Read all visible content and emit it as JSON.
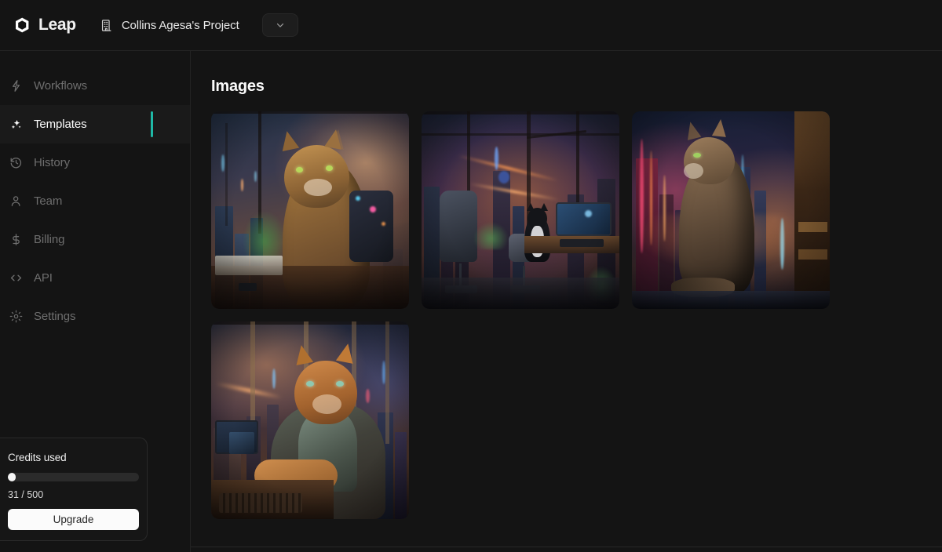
{
  "header": {
    "brand_name": "Leap",
    "brand_logo_icon": "cube-logo-icon",
    "project_icon": "building-icon",
    "project_name": "Collins Agesa's Project",
    "dropdown_icon": "chevron-down-icon"
  },
  "sidebar": {
    "items": [
      {
        "label": "Workflows",
        "icon": "lightning-bolt-icon",
        "active": false
      },
      {
        "label": "Templates",
        "icon": "sparkles-icon",
        "active": true
      },
      {
        "label": "History",
        "icon": "clock-rotate-icon",
        "active": false
      },
      {
        "label": "Team",
        "icon": "person-icon",
        "active": false
      },
      {
        "label": "Billing",
        "icon": "dollar-sign-icon",
        "active": false
      },
      {
        "label": "API",
        "icon": "code-brackets-icon",
        "active": false
      },
      {
        "label": "Settings",
        "icon": "gear-icon",
        "active": false
      }
    ],
    "active_indicator_color": "#1fb8a6",
    "credits": {
      "title": "Credits used",
      "used": 31,
      "total": 500,
      "count_label": "31 / 500",
      "percent": 6.2,
      "upgrade_label": "Upgrade"
    }
  },
  "main": {
    "page_title": "Images",
    "images": [
      {
        "alt": "Cyberpunk tabby cat with cybernetic harness at office desk overlooking neon city at sunset"
      },
      {
        "alt": "Dark office interior with black cat on chair facing floor-to-ceiling windows over a glowing night city"
      },
      {
        "alt": "Long-haired tabby cat sitting in profile against a neon skyscraper skyline"
      },
      {
        "alt": "Ginger cat in patterned jacket at a keyboard with a futuristic city skyline behind"
      }
    ]
  }
}
